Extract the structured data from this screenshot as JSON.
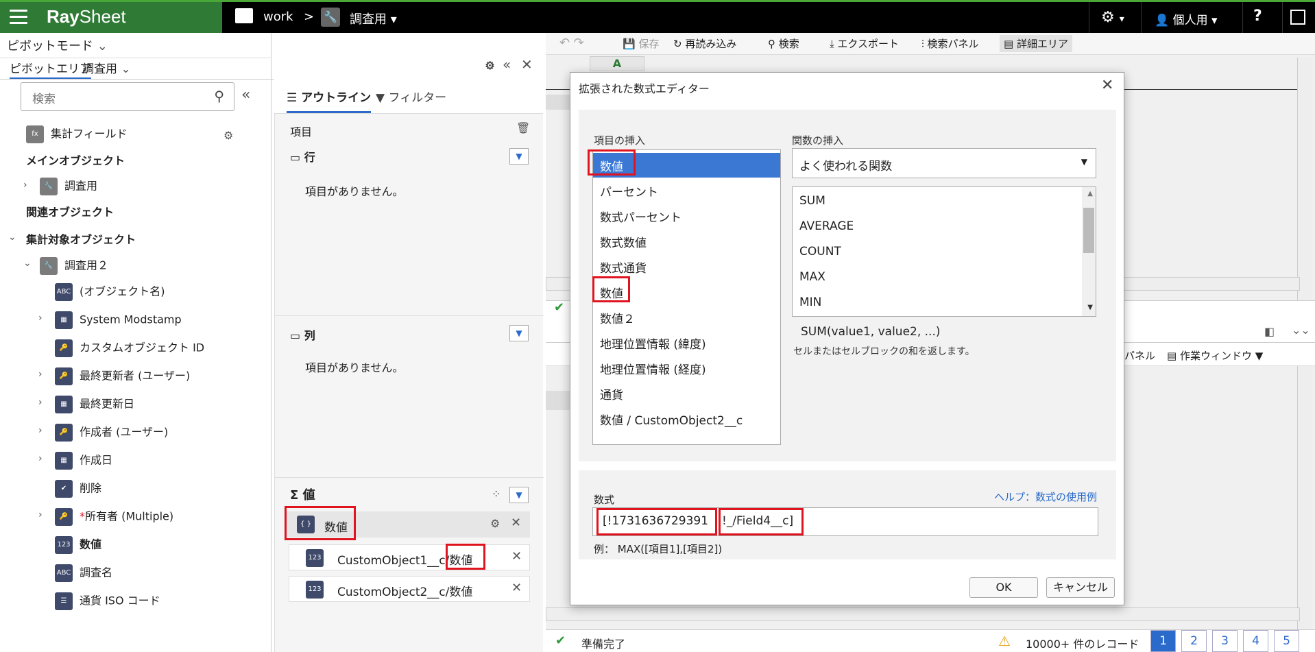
{
  "topbar": {
    "logo_ray": "Ray",
    "logo_sheet": "Sheet",
    "crumb_work": "work",
    "crumb_sep": ">",
    "crumb_object": "調査用",
    "user_label": "個人用",
    "help": "?"
  },
  "left": {
    "mode": "ピボットモード",
    "tab_pivot_area": "ピボットエリア",
    "tab_object": "調査用",
    "search_placeholder": "検索",
    "calc_field": "集計フィールド",
    "main_object_header": "メインオブジェクト",
    "main_object": "調査用",
    "related_header": "関連オブジェクト",
    "target_header": "集計対象オブジェクト",
    "target_object": "調査用２",
    "fields": [
      {
        "icon": "ABC",
        "label": "(オブジェクト名)"
      },
      {
        "icon": "cal",
        "label": "System Modstamp"
      },
      {
        "icon": "key",
        "label": "カスタムオブジェクト ID"
      },
      {
        "icon": "key",
        "label": "最終更新者 (ユーザー)"
      },
      {
        "icon": "cal",
        "label": "最終更新日"
      },
      {
        "icon": "key",
        "label": "作成者 (ユーザー)"
      },
      {
        "icon": "cal",
        "label": "作成日"
      },
      {
        "icon": "check",
        "label": "削除"
      },
      {
        "icon": "key",
        "label": "所有者 (Multiple)"
      },
      {
        "icon": "123",
        "label": "数値"
      },
      {
        "icon": "ABC",
        "label": "調査名"
      },
      {
        "icon": "list",
        "label": "通貨 ISO コード"
      }
    ],
    "required_mark": "*"
  },
  "mid": {
    "tab_outline": "アウトライン",
    "tab_filter": "フィルター",
    "items_header": "項目",
    "rows_label": "行",
    "no_items": "項目がありません。",
    "cols_label": "列",
    "values_label": "値",
    "value_chip": "数値",
    "sub_values": [
      "CustomObject1__c/数値",
      "CustomObject2__c/数値"
    ]
  },
  "toolbar": {
    "save": "保存",
    "reload": "再読み込み",
    "search": "検索",
    "export": "エクスポート",
    "search_panel": "検索パネル",
    "detail_area": "詳細エリア",
    "col_a": "A",
    "panel": "パネル",
    "work_window": "作業ウィンドウ"
  },
  "modal": {
    "title": "拡張された数式エディター",
    "insert_item_label": "項目の挿入",
    "insert_func_label": "関数の挿入",
    "items": [
      "数値",
      "パーセント",
      "数式パーセント",
      "数式数値",
      "数式通貨",
      "数値",
      "数値２",
      "地理位置情報 (緯度)",
      "地理位置情報 (経度)",
      "通貨",
      "数値 / CustomObject2__c"
    ],
    "func_select": "よく使われる関数",
    "functions": [
      "SUM",
      "AVERAGE",
      "COUNT",
      "MAX",
      "MIN"
    ],
    "func_signature": "SUM(value1, value2, ...)",
    "func_desc": "セルまたはセルブロックの和を返します。",
    "formula_label": "数式",
    "help_link": "ヘルプ：数式の使用例",
    "formula_part1": "[!1731636729391",
    "formula_part2": "!_/Field4__c]",
    "example": "例：  MAX([項目1],[項目2])",
    "ok": "OK",
    "cancel": "キャンセル"
  },
  "status": {
    "ready": "準備完了",
    "records": "10000+ 件のレコード",
    "pages": [
      "1",
      "2",
      "3",
      "4",
      "5"
    ]
  },
  "colors": {
    "topbar": "#000000",
    "brand_green": "#2f7a35",
    "accent_blue": "#2a6acb",
    "highlight": "#e0141e",
    "selected_item": "#3a78d4"
  }
}
